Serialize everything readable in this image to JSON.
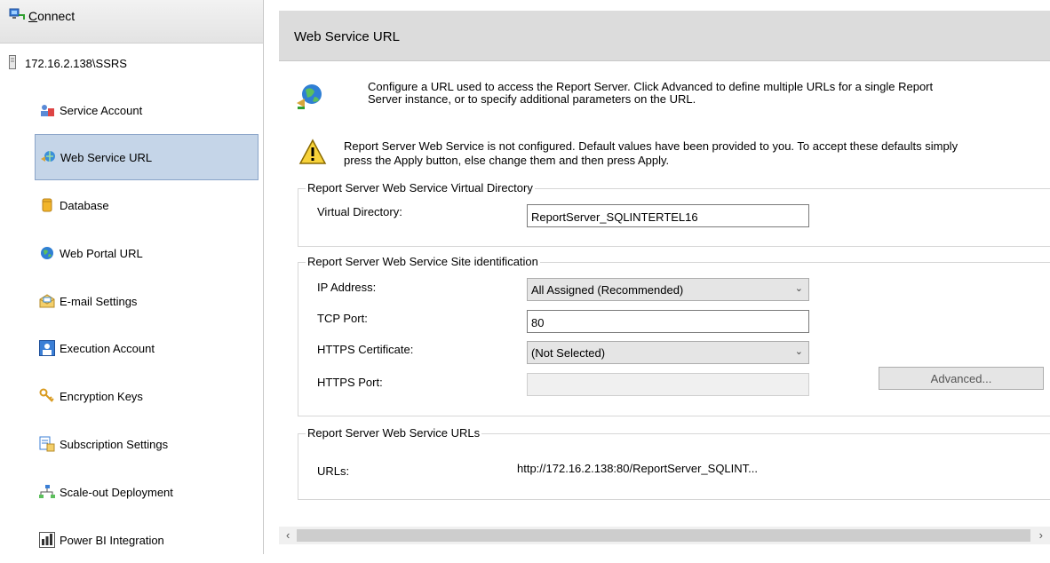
{
  "sidebar": {
    "connect_label": "Connect",
    "server_name": "172.16.2.138\\SSRS",
    "items": [
      {
        "label": "Service Account",
        "icon": "service-account-icon"
      },
      {
        "label": "Web Service URL",
        "icon": "web-service-url-icon",
        "active": true
      },
      {
        "label": "Database",
        "icon": "database-icon"
      },
      {
        "label": "Web Portal URL",
        "icon": "globe-icon"
      },
      {
        "label": "E-mail Settings",
        "icon": "email-icon"
      },
      {
        "label": "Execution Account",
        "icon": "execution-account-icon"
      },
      {
        "label": "Encryption Keys",
        "icon": "keys-icon"
      },
      {
        "label": "Subscription Settings",
        "icon": "subscription-icon"
      },
      {
        "label": "Scale-out Deployment",
        "icon": "scale-out-icon"
      },
      {
        "label": "Power BI Integration",
        "icon": "power-bi-icon"
      }
    ]
  },
  "main": {
    "title": "Web Service URL",
    "intro_line1": "Configure a URL used to access the Report Server.  Click Advanced to define multiple URLs for a single Report",
    "intro_line2": "Server instance, or to specify additional parameters on the URL.",
    "warning_line1": "Report Server Web Service is not configured. Default values have been provided to you. To accept these defaults simply",
    "warning_line2": "press the Apply button, else change them and then press Apply.",
    "vdir_group": {
      "legend": "Report Server Web Service Virtual Directory",
      "vdir_label": "Virtual Directory:",
      "vdir_value": "ReportServer_SQLINTERTEL16"
    },
    "site_group": {
      "legend": "Report Server Web Service Site identification",
      "ip_label": "IP Address:",
      "ip_value": "All Assigned (Recommended)",
      "tcp_label": "TCP Port:",
      "tcp_value": "80",
      "cert_label": "HTTPS Certificate:",
      "cert_value": "(Not Selected)",
      "https_port_label": "HTTPS Port:",
      "https_port_value": "",
      "advanced_label": "Advanced..."
    },
    "urls_group": {
      "legend": "Report Server Web Service URLs",
      "urls_label": "URLs:",
      "urls_value": "http://172.16.2.138:80/ReportServer_SQLINT..."
    }
  },
  "colors": {
    "active_item_bg": "#c5d5e8",
    "header_bg": "#dcdcdc"
  }
}
